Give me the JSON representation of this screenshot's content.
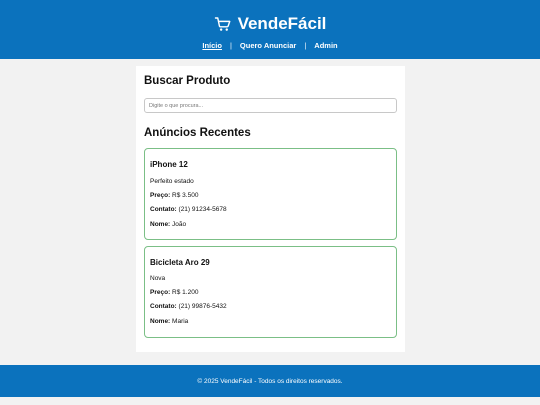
{
  "header": {
    "brand": "VendeFácil",
    "nav": [
      {
        "label": "Início"
      },
      {
        "label": "Quero Anunciar"
      },
      {
        "label": "Admin"
      }
    ],
    "separator": "|"
  },
  "search": {
    "title": "Buscar Produto",
    "placeholder": "Digite o que procura..."
  },
  "listings": {
    "title": "Anúncios Recentes",
    "price_label": "Preço:",
    "contact_label": "Contato:",
    "name_label": "Nome:",
    "items": [
      {
        "title": "iPhone 12",
        "description": "Perfeito estado",
        "price": "R$ 3.500",
        "contact": "(21) 91234-5678",
        "name": "João"
      },
      {
        "title": "Bicicleta Aro 29",
        "description": "Nova",
        "price": "R$ 1.200",
        "contact": "(21) 99876-5432",
        "name": "Maria"
      }
    ]
  },
  "footer": {
    "text": "© 2025 VendeFácil - Todos os direitos reservados."
  },
  "colors": {
    "header_bg": "#0b72bd",
    "card_border": "#7bbf86"
  }
}
